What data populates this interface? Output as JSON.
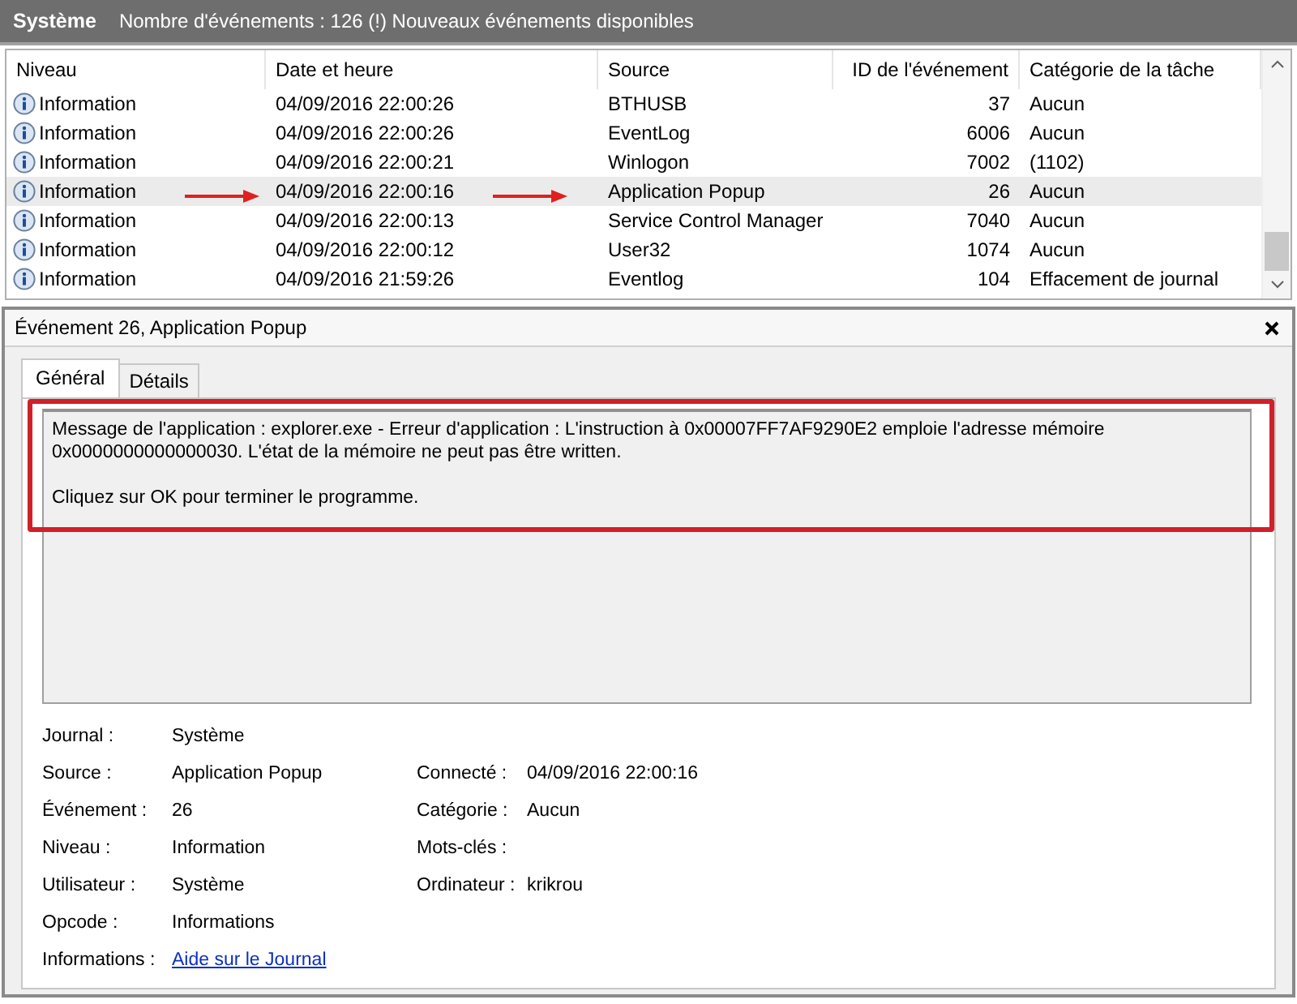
{
  "header": {
    "title": "Système",
    "subtitle": "Nombre d'événements : 126 (!) Nouveaux événements disponibles"
  },
  "table": {
    "columns": [
      "Niveau",
      "Date et heure",
      "Source",
      "ID de l'événement",
      "Catégorie de la tâche"
    ],
    "rows": [
      {
        "level": "Information",
        "date": "04/09/2016 22:00:26",
        "source": "BTHUSB",
        "id": "37",
        "category": "Aucun",
        "selected": false
      },
      {
        "level": "Information",
        "date": "04/09/2016 22:00:26",
        "source": "EventLog",
        "id": "6006",
        "category": "Aucun",
        "selected": false
      },
      {
        "level": "Information",
        "date": "04/09/2016 22:00:21",
        "source": "Winlogon",
        "id": "7002",
        "category": "(1102)",
        "selected": false
      },
      {
        "level": "Information",
        "date": "04/09/2016 22:00:16",
        "source": "Application Popup",
        "id": "26",
        "category": "Aucun",
        "selected": true
      },
      {
        "level": "Information",
        "date": "04/09/2016 22:00:13",
        "source": "Service Control Manager",
        "id": "7040",
        "category": "Aucun",
        "selected": false
      },
      {
        "level": "Information",
        "date": "04/09/2016 22:00:12",
        "source": "User32",
        "id": "1074",
        "category": "Aucun",
        "selected": false
      },
      {
        "level": "Information",
        "date": "04/09/2016 21:59:26",
        "source": "Eventlog",
        "id": "104",
        "category": "Effacement de journal",
        "selected": false
      }
    ]
  },
  "detail": {
    "title": "Événement 26, Application Popup",
    "tabs": [
      {
        "label": "Général",
        "selected": true
      },
      {
        "label": "Détails",
        "selected": false
      }
    ],
    "message": [
      "Message de l'application : explorer.exe - Erreur d'application : L'instruction à 0x00007FF7AF9290E2 emploie l'adresse mémoire 0x0000000000000030. L'état de la mémoire ne peut pas être written.",
      "Cliquez sur OK pour terminer le programme."
    ],
    "fields": [
      {
        "left": {
          "label": "Journal :",
          "value": "Système"
        }
      },
      {
        "left": {
          "label": "Source :",
          "value": "Application Popup"
        },
        "right": {
          "label": "Connecté :",
          "value": "04/09/2016 22:00:16"
        }
      },
      {
        "left": {
          "label": "Événement :",
          "value": "26"
        },
        "right": {
          "label": "Catégorie :",
          "value": "Aucun"
        }
      },
      {
        "left": {
          "label": "Niveau :",
          "value": "Information"
        },
        "right": {
          "label": "Mots-clés :"
        }
      },
      {
        "left": {
          "label": "Utilisateur :",
          "value": "Système"
        },
        "right": {
          "label": "Ordinateur :",
          "value": "krikrou"
        }
      },
      {
        "left": {
          "label": "Opcode :",
          "value": "Informations"
        }
      }
    ],
    "help": {
      "label": "Informations :",
      "link": "Aide sur le Journal"
    }
  }
}
